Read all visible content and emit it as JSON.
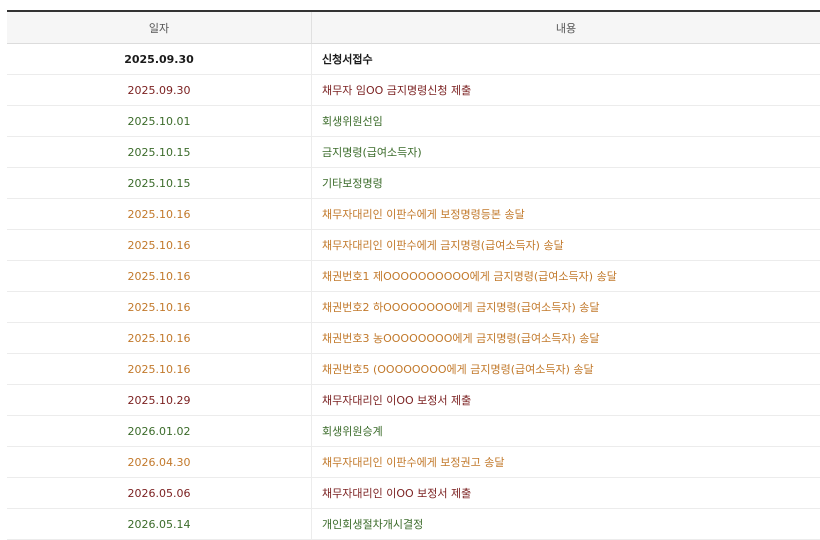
{
  "header": {
    "date_label": "일자",
    "content_label": "내용"
  },
  "rows": [
    {
      "date": "2025.09.30",
      "content": "신청서접수",
      "style": "s-black"
    },
    {
      "date": "2025.09.30",
      "content": "채무자 임OO 금지명령신청 제출",
      "style": "s-maroon"
    },
    {
      "date": "2025.10.01",
      "content": "회생위원선임",
      "style": "s-green"
    },
    {
      "date": "2025.10.15",
      "content": "금지명령(급여소득자)",
      "style": "s-green"
    },
    {
      "date": "2025.10.15",
      "content": "기타보정명령",
      "style": "s-green"
    },
    {
      "date": "2025.10.16",
      "content": "채무자대리인 이판수에게 보정명령등본 송달",
      "style": "s-orange"
    },
    {
      "date": "2025.10.16",
      "content": "채무자대리인 이판수에게 금지명령(급여소득자) 송달",
      "style": "s-orange"
    },
    {
      "date": "2025.10.16",
      "content": "채권번호1 제OOOOOOOOOO에게 금지명령(급여소득자) 송달",
      "style": "s-orange"
    },
    {
      "date": "2025.10.16",
      "content": "채권번호2 하OOOOOOOO에게 금지명령(급여소득자) 송달",
      "style": "s-orange"
    },
    {
      "date": "2025.10.16",
      "content": "채권번호3 농OOOOOOOO에게 금지명령(급여소득자) 송달",
      "style": "s-orange"
    },
    {
      "date": "2025.10.16",
      "content": "채권번호5 (OOOOOOOO에게 금지명령(급여소득자) 송달",
      "style": "s-orange"
    },
    {
      "date": "2025.10.29",
      "content": "채무자대리인 이OO 보정서 제출",
      "style": "s-maroon"
    },
    {
      "date": "2026.01.02",
      "content": "회생위원승계",
      "style": "s-green"
    },
    {
      "date": "2026.04.30",
      "content": "채무자대리인 이판수에게 보정권고 송달",
      "style": "s-orange"
    },
    {
      "date": "2026.05.06",
      "content": "채무자대리인 이OO 보정서 제출",
      "style": "s-maroon"
    },
    {
      "date": "2026.05.14",
      "content": "개인회생절차개시결정",
      "style": "s-green"
    }
  ]
}
